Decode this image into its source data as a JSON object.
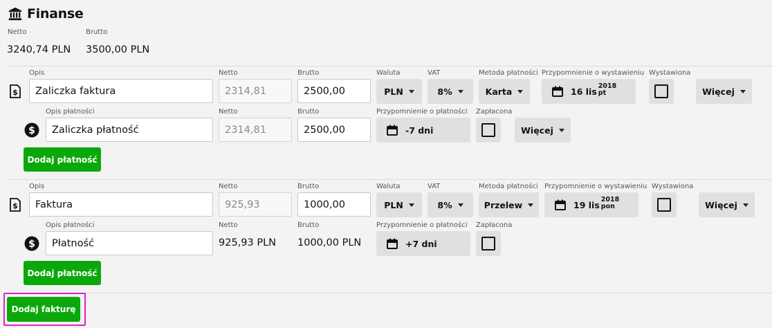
{
  "header": {
    "title": "Finanse",
    "icon": "bank-icon"
  },
  "summary": {
    "netto_label": "Netto",
    "netto_value": "3240,74 PLN",
    "brutto_label": "Brutto",
    "brutto_value": "3500,00 PLN"
  },
  "invoices": [
    {
      "opis_label": "Opis",
      "opis": "Zaliczka faktura",
      "netto_label": "Netto",
      "netto": "2314,81",
      "brutto_label": "Brutto",
      "brutto": "2500,00",
      "waluta_label": "Waluta",
      "waluta": "PLN",
      "vat_label": "VAT",
      "vat": "8%",
      "metoda_label": "Metoda płatności",
      "metoda": "Karta",
      "przyp_label": "Przypomnienie o wystawieniu",
      "przyp_day": "16 lis",
      "przyp_year": "2018",
      "przyp_weekday": "pt",
      "wystawiona_label": "Wystawiona",
      "wiecej": "Więcej",
      "payment": {
        "opis_label": "Opis płatności",
        "opis": "Zaliczka płatność",
        "netto_label": "Netto",
        "netto": "2314,81",
        "brutto_label": "Brutto",
        "brutto": "2500,00",
        "przyp_label": "Przypomnienie o płatności",
        "przyp": "-7 dni",
        "zaplacona_label": "Zapłacona",
        "wiecej": "Więcej"
      },
      "add_payment": "Dodaj płatność"
    },
    {
      "opis_label": "Opis",
      "opis": "Faktura",
      "netto_label": "Netto",
      "netto": "925,93",
      "brutto_label": "Brutto",
      "brutto": "1000,00",
      "waluta_label": "Waluta",
      "waluta": "PLN",
      "vat_label": "VAT",
      "vat": "8%",
      "metoda_label": "Metoda płatności",
      "metoda": "Przelew",
      "przyp_label": "Przypomnienie o wystawieniu",
      "przyp_day": "19 lis",
      "przyp_year": "2018",
      "przyp_weekday": "pon",
      "wystawiona_label": "Wystawiona",
      "wiecej": "Więcej",
      "payment": {
        "opis_label": "Opis płatności",
        "opis": "Płatność",
        "netto_label": "Netto",
        "netto": "925,93 PLN",
        "brutto_label": "Brutto",
        "brutto": "1000,00 PLN",
        "przyp_label": "Przypomnienie o płatności",
        "przyp": "+7 dni",
        "zaplacona_label": "Zapłacona"
      },
      "add_payment": "Dodaj płatność"
    }
  ],
  "add_invoice": "Dodaj fakturę",
  "colors": {
    "primary_green": "#0aa80a",
    "highlight": "#e020c8",
    "button_grey": "#e0e0e0"
  }
}
